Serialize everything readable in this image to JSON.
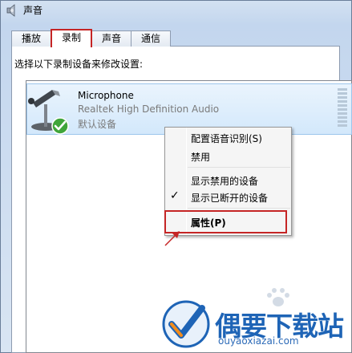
{
  "window": {
    "title": "声音"
  },
  "tabs": [
    {
      "label": "播放"
    },
    {
      "label": "录制"
    },
    {
      "label": "声音"
    },
    {
      "label": "通信"
    }
  ],
  "instruction": "选择以下录制设备来修改设置:",
  "device": {
    "name": "Microphone",
    "driver": "Realtek High Definition Audio",
    "status": "默认设备"
  },
  "context_menu": {
    "items": [
      {
        "label": "配置语音识别(S)"
      },
      {
        "label": "禁用"
      },
      {
        "label": "显示禁用的设备"
      },
      {
        "label": "显示已断开的设备",
        "checked": true
      },
      {
        "label": "属性(P)"
      }
    ]
  },
  "watermark": {
    "title": "偶要下载站",
    "url": "ouyaoxiazai.com"
  },
  "colors": {
    "highlight_border": "#c52525",
    "selection_bg": "#d3e8fb",
    "watermark": "#1e64b6"
  },
  "icons": [
    "speaker-icon",
    "microphone-icon",
    "default-check-icon",
    "checkmark-icon",
    "arrow-icon",
    "watermark-logo",
    "paw-icon"
  ]
}
